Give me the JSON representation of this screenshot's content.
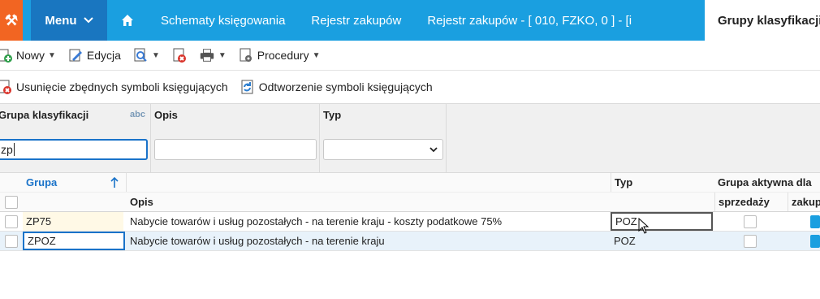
{
  "topbar": {
    "logo_glyph": "⚒",
    "menu_label": "Menu",
    "tabs": [
      {
        "label": "Schematy księgowania"
      },
      {
        "label": "Rejestr zakupów"
      },
      {
        "label": "Rejestr zakupów - [ 010, FZKO, 0 ] - [i"
      },
      {
        "label": "Grupy klasyfikacji",
        "active": true
      }
    ]
  },
  "toolbar": {
    "new_label": "Nowy",
    "edit_label": "Edycja",
    "procedures_label": "Procedury"
  },
  "toolbar2": {
    "remove_label": "Usunięcie zbędnych symboli księgujących",
    "restore_label": "Odtworzenie symboli księgujących"
  },
  "filters": {
    "group_label": "Grupa klasyfikacji",
    "group_value": "zp",
    "abc_label": "abc",
    "description_label": "Opis",
    "description_value": "",
    "type_label": "Typ",
    "type_value": ""
  },
  "grid": {
    "headers": {
      "group": "Grupa",
      "description": "Opis",
      "type": "Typ",
      "active_for": "Grupa aktywna dla",
      "sales": "sprzedaży",
      "purchases": "zakupów"
    },
    "rows": [
      {
        "group": "ZP75",
        "description": "Nabycie towarów i usług pozostałych -  na terenie kraju -  koszty podatkowe 75%",
        "type": "POZ",
        "sales": false,
        "purchases": true
      },
      {
        "group": "ZPOZ",
        "description": "Nabycie towarów i usług pozostałych -  na terenie kraju",
        "type": "POZ",
        "sales": false,
        "purchases": true
      }
    ]
  },
  "colors": {
    "topbar": "#1a9fe0",
    "menu": "#1976c0",
    "logo": "#f26522",
    "accent": "#1a73c9"
  }
}
